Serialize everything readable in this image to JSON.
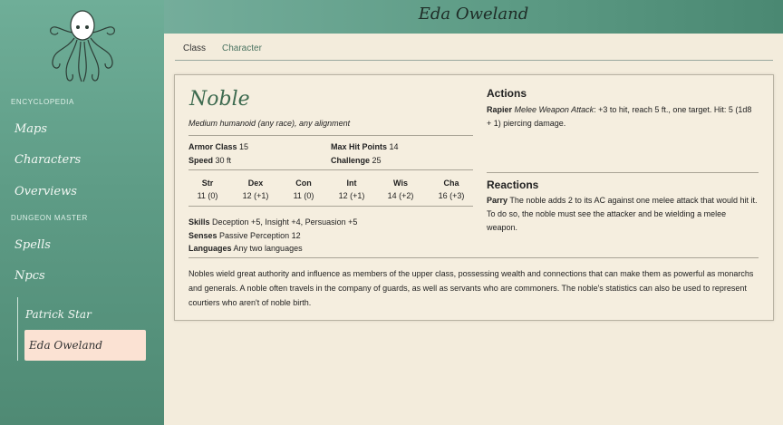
{
  "header": {
    "title": "Eda Oweland"
  },
  "sidebar": {
    "sections": {
      "encyclopedia": "ENCYCLOPEDIA",
      "dungeon_master": "DUNGEON MASTER"
    },
    "items": {
      "maps": "Maps",
      "characters": "Characters",
      "overviews": "Overviews",
      "spells": "Spells",
      "npcs": "Npcs"
    },
    "npcs_sub": [
      "Patrick Star",
      "Eda Oweland"
    ],
    "logo_icon": "octopus-icon"
  },
  "tabs": [
    "Class",
    "Character"
  ],
  "npc": {
    "name": "Noble",
    "subtitle": "Medium humanoid (any race), any alignment",
    "armor_class": {
      "label": "Armor Class",
      "value": "15"
    },
    "max_hit_points": {
      "label": "Max Hit Points",
      "value": "14"
    },
    "speed": {
      "label": "Speed",
      "value": "30 ft"
    },
    "challenge": {
      "label": "Challenge",
      "value": "25"
    },
    "abilities": [
      {
        "name": "Str",
        "value": "11 (0)"
      },
      {
        "name": "Dex",
        "value": "12 (+1)"
      },
      {
        "name": "Con",
        "value": "11 (0)"
      },
      {
        "name": "Int",
        "value": "12 (+1)"
      },
      {
        "name": "Wis",
        "value": "14 (+2)"
      },
      {
        "name": "Cha",
        "value": "16 (+3)"
      }
    ],
    "skills": {
      "label": "Skills",
      "value": "Deception +5, Insight +4, Persuasion +5"
    },
    "senses": {
      "label": "Senses",
      "value": "Passive Perception 12"
    },
    "languages": {
      "label": "Languages",
      "value": "Any two languages"
    },
    "actions": {
      "title": "Actions",
      "name": "Rapier",
      "type": "Melee Weapon Attack",
      "text": ": +3 to hit, reach 5 ft., one target. Hit: 5 (1d8 + 1) piercing damage."
    },
    "reactions": {
      "title": "Reactions",
      "name": "Parry",
      "text": "The noble adds 2 to its AC against one melee attack that would hit it. To do so, the noble must see the attacker and be wielding a melee weapon."
    },
    "description": "Nobles wield great authority and influence as members of the upper class, possessing wealth and connections that can make them as powerful as monarchs and generals. A noble often travels in the company of guards, as well as servants who are commoners. The noble's statistics can also be used to represent courtiers who aren't of noble birth."
  },
  "colors": {
    "sidebar": "#5e9c86",
    "active_item": "#fbe2d3",
    "npc_name": "#3d6a4f",
    "parchment": "#f3ecdc"
  }
}
